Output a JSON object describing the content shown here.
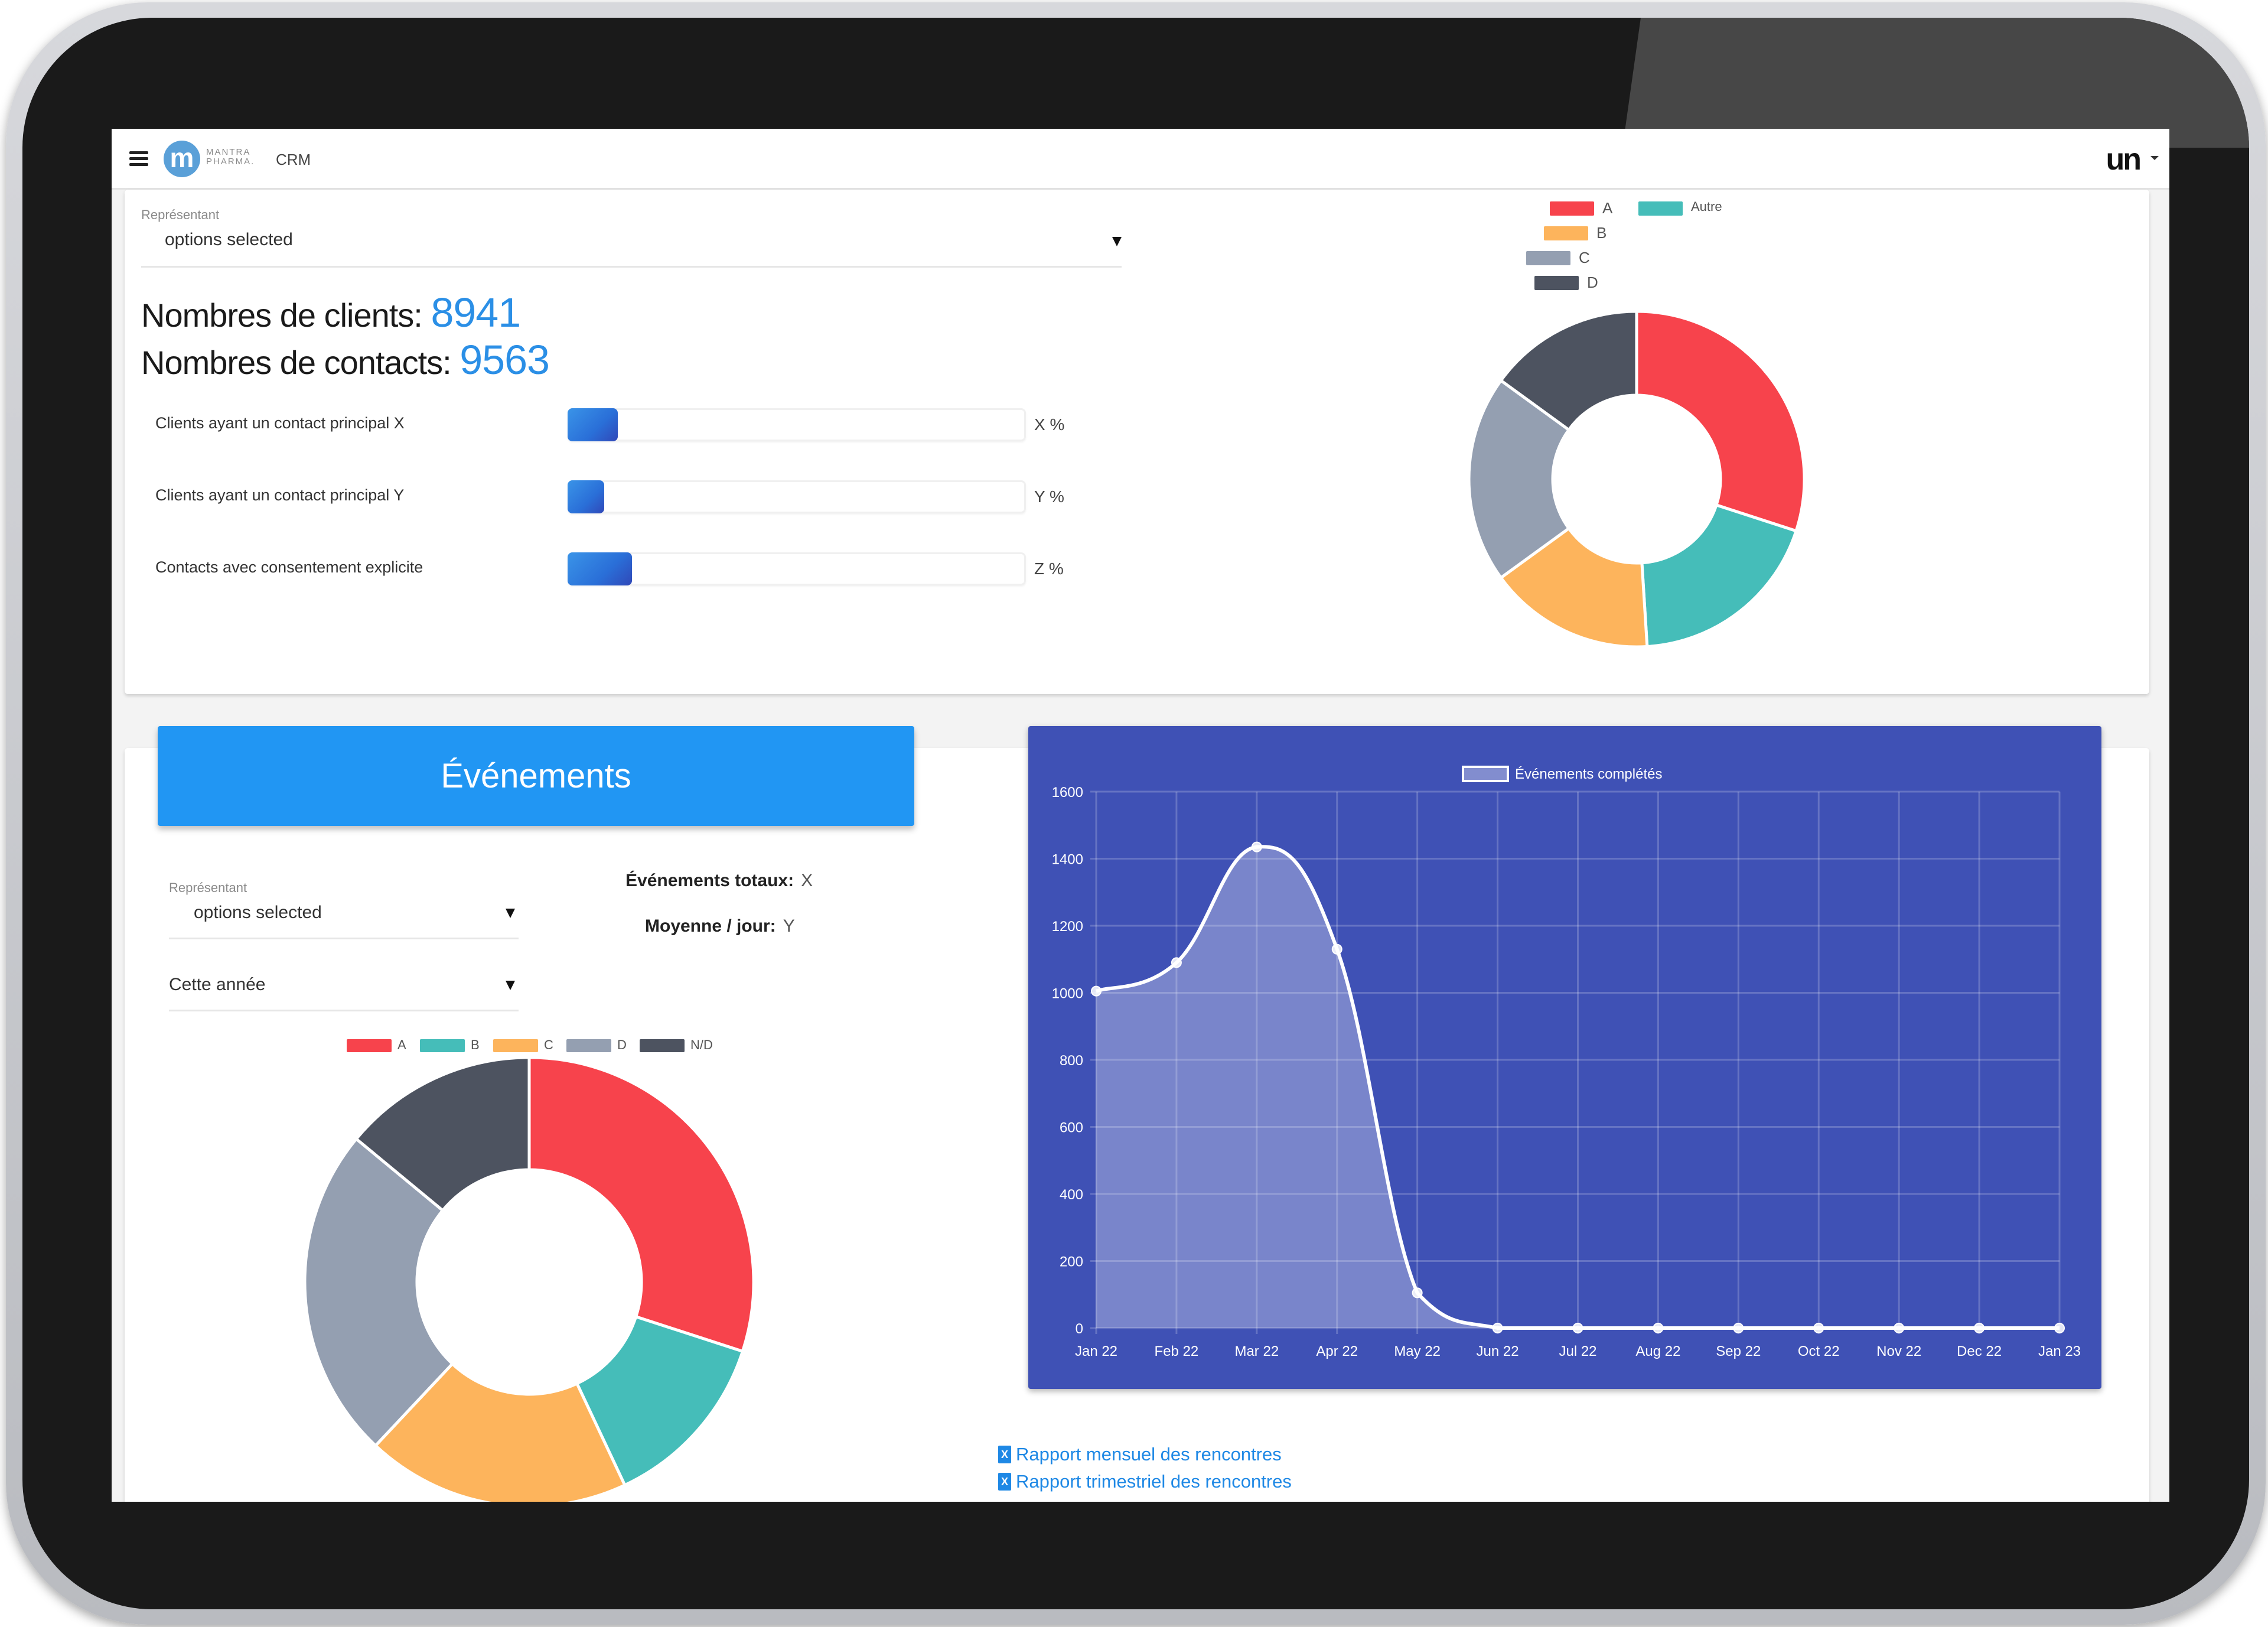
{
  "header": {
    "menu_icon": "hamburger-icon",
    "logo_letter": "m",
    "logo_line1": "MANTRA",
    "logo_line2": "PHARMA.",
    "app_name": "CRM",
    "user_brand": "un"
  },
  "overview": {
    "rep_filter": {
      "label": "Représentant",
      "value": "options selected"
    },
    "clients": {
      "label": "Nombres de clients:",
      "value": "8941"
    },
    "contacts": {
      "label": "Nombres de contacts:",
      "value": "9563"
    },
    "progress": [
      {
        "label": "Clients ayant un contact principal X",
        "value_text": "X %",
        "fill_percent": 11
      },
      {
        "label": "Clients ayant un contact principal Y",
        "value_text": "Y %",
        "fill_percent": 8
      },
      {
        "label": "Contacts avec consentement explicite",
        "value_text": "Z %",
        "fill_percent": 14
      }
    ]
  },
  "events": {
    "banner_title": "Événements",
    "rep_filter": {
      "label": "Représentant",
      "value": "options selected"
    },
    "period_filter": {
      "value": "Cette année"
    },
    "total_label": "Événements totaux:",
    "total_value": "X",
    "avg_label": "Moyenne / jour:",
    "avg_value": "Y",
    "reports": [
      {
        "label": "Rapport mensuel des rencontres",
        "icon": "excel-file-icon"
      },
      {
        "label": "Rapport trimestriel des rencontres",
        "icon": "excel-file-icon"
      }
    ]
  },
  "colors": {
    "red": "#f7434c",
    "teal": "#45bdb9",
    "orange": "#fdb45c",
    "gray": "#949fb1",
    "dark": "#4d5360",
    "accent": "#2196f3",
    "chart_bg": "#3f51b5"
  },
  "chart_data": [
    {
      "type": "pie",
      "variant": "doughnut",
      "title": "",
      "legend_position": "top",
      "labels": [
        "A",
        "Autre",
        "B",
        "C",
        "D"
      ],
      "values": [
        30,
        19,
        16,
        20,
        15
      ],
      "colors": [
        "#f7434c",
        "#45bdb9",
        "#fdb45c",
        "#949fb1",
        "#4d5360"
      ]
    },
    {
      "type": "pie",
      "variant": "doughnut",
      "title": "",
      "legend_position": "top",
      "labels": [
        "A",
        "B",
        "C",
        "D",
        "N/D"
      ],
      "values": [
        30,
        13,
        19,
        24,
        14
      ],
      "colors": [
        "#f7434c",
        "#45bdb9",
        "#fdb45c",
        "#949fb1",
        "#4d5360"
      ]
    },
    {
      "type": "area",
      "title": "",
      "legend_position": "top",
      "series": [
        {
          "name": "Événements complétés",
          "values": [
            1005,
            1090,
            1435,
            1130,
            105,
            0,
            0,
            0,
            0,
            0,
            0,
            0,
            0
          ]
        }
      ],
      "categories": [
        "Jan 22",
        "Feb 22",
        "Mar 22",
        "Apr 22",
        "May 22",
        "Jun 22",
        "Jul 22",
        "Aug 22",
        "Sep 22",
        "Oct 22",
        "Nov 22",
        "Dec 22",
        "Jan 23"
      ],
      "yticks": [
        0,
        200,
        400,
        600,
        800,
        1000,
        1200,
        1400,
        1600
      ],
      "ylim": [
        0,
        1600
      ],
      "xlabel": "",
      "ylabel": "",
      "grid": true
    }
  ]
}
